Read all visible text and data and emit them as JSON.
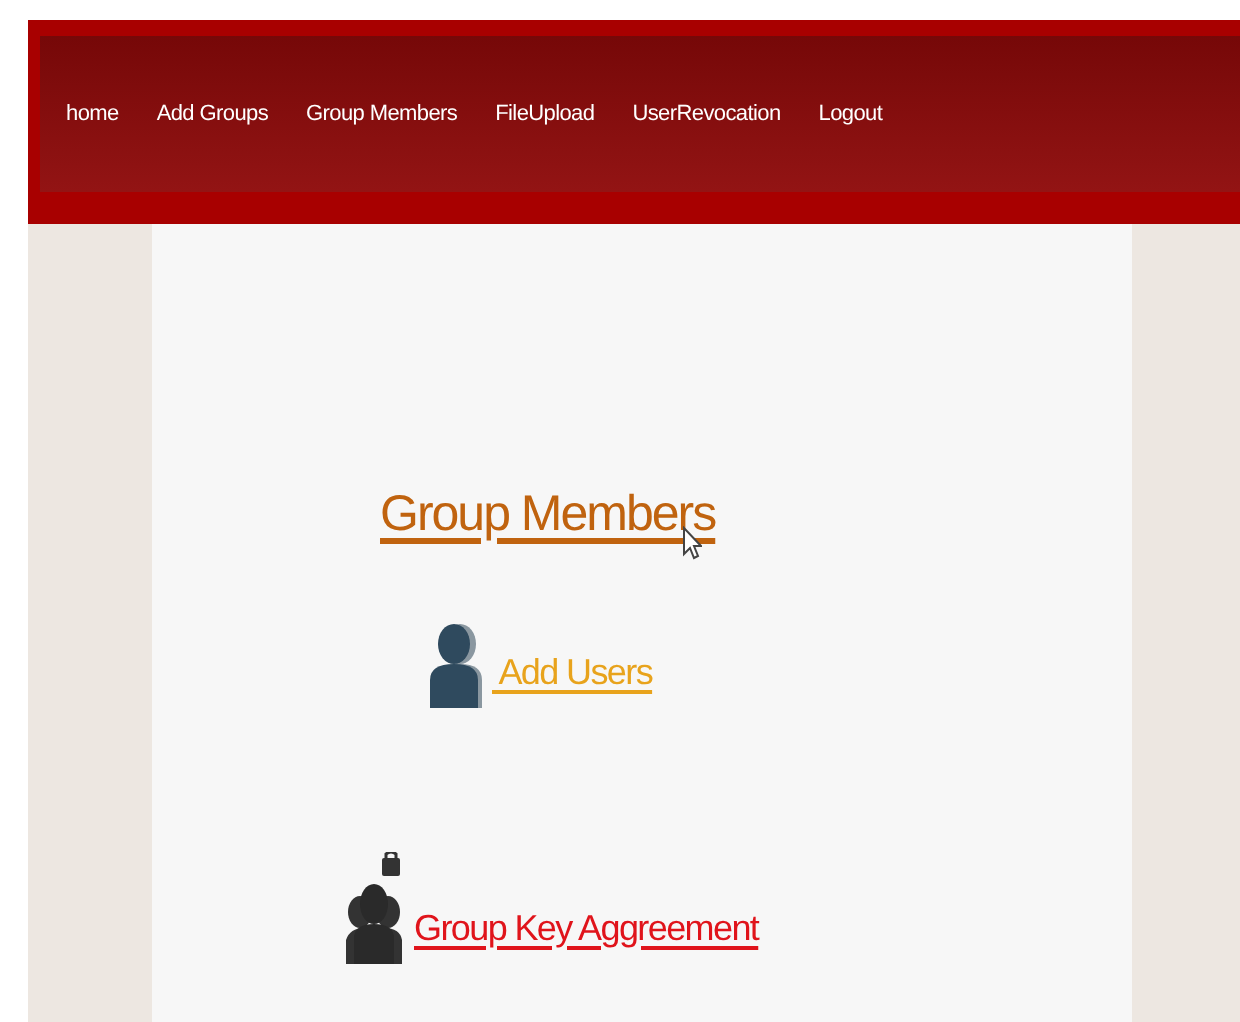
{
  "nav": [
    {
      "label": "home"
    },
    {
      "label": "Add Groups"
    },
    {
      "label": "Group Members"
    },
    {
      "label": "FileUpload"
    },
    {
      "label": "UserRevocation"
    },
    {
      "label": "Logout"
    }
  ],
  "heading": "Group Members",
  "links": [
    {
      "label": " Add Users",
      "kind": "user",
      "color": "#e8a31c"
    },
    {
      "label": "Group Key Aggreement",
      "kind": "group-lock",
      "color": "#e0141b"
    }
  ]
}
